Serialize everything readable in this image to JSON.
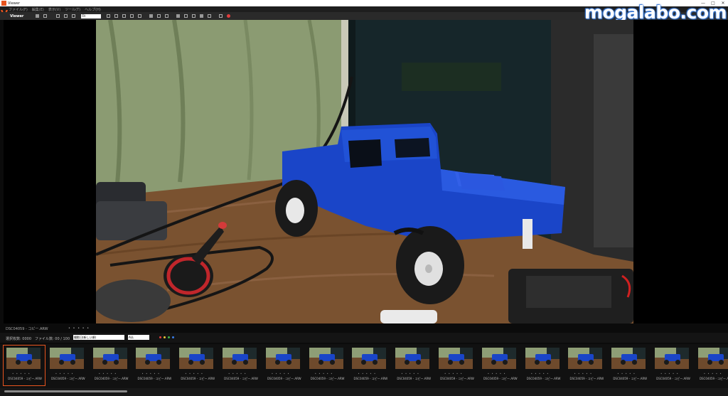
{
  "window": {
    "title": "Viewer",
    "controls": [
      "—",
      "□",
      "✕"
    ]
  },
  "menu": [
    "ファイル(F)",
    "編集(E)",
    "表示(V)",
    "ツール(T)",
    "ヘルプ(H)"
  ],
  "toolbar": {
    "view_label": "Viewer",
    "zoom_value": "Fit"
  },
  "watermark": "mogalabo.com",
  "viewer": {
    "filename": "DSC04059 - コピー.ARW",
    "dots": "• • • • •"
  },
  "tray": {
    "selection_label": "選択枚数: 0000",
    "file_count_label": "ファイル数: 00 / 100",
    "sort_value": "撮影日(新しい順)",
    "filter_value": "ALL",
    "color_labels": [
      "#e23d3d",
      "#e6c43a",
      "#3cb44b",
      "#3a7be6"
    ]
  },
  "thumbnails": [
    {
      "caption": "DSC04059 - コピー.ARW",
      "stars": "• • • • •",
      "selected": true
    },
    {
      "caption": "DSC04059 - コピー.ARW",
      "stars": "• • • • •",
      "selected": false
    },
    {
      "caption": "DSC04059 - コピー.ARW",
      "stars": "• • • • •",
      "selected": false
    },
    {
      "caption": "DSC04059 - コピー.ARW",
      "stars": "• • • • •",
      "selected": false
    },
    {
      "caption": "DSC04059 - コピー.ARW",
      "stars": "• • • • •",
      "selected": false
    },
    {
      "caption": "DSC04059 - コピー.ARW",
      "stars": "• • • • •",
      "selected": false
    },
    {
      "caption": "DSC04059 - コピー.ARW",
      "stars": "• • • • •",
      "selected": false
    },
    {
      "caption": "DSC04059 - コピー.ARW",
      "stars": "• • • • •",
      "selected": false
    },
    {
      "caption": "DSC04059 - コピー.ARW",
      "stars": "• • • • •",
      "selected": false
    },
    {
      "caption": "DSC04059 - コピー.ARW",
      "stars": "• • • • •",
      "selected": false
    },
    {
      "caption": "DSC04059 - コピー.ARW",
      "stars": "• • • • •",
      "selected": false
    },
    {
      "caption": "DSC04059 - コピー.ARW",
      "stars": "• • • • •",
      "selected": false
    },
    {
      "caption": "DSC04059 - コピー.ARW",
      "stars": "• • • • •",
      "selected": false
    },
    {
      "caption": "DSC04059 - コピー.ARW",
      "stars": "• • • • •",
      "selected": false
    },
    {
      "caption": "DSC04059 - コピー.ARW",
      "stars": "• • • • •",
      "selected": false
    },
    {
      "caption": "DSC04059 - コピー.ARW",
      "stars": "• • • • •",
      "selected": false
    },
    {
      "caption": "DSC04059 - コピー.ARW",
      "stars": "• • • • •",
      "selected": false
    }
  ],
  "photo": {
    "subject": "blue-rc-truck"
  }
}
